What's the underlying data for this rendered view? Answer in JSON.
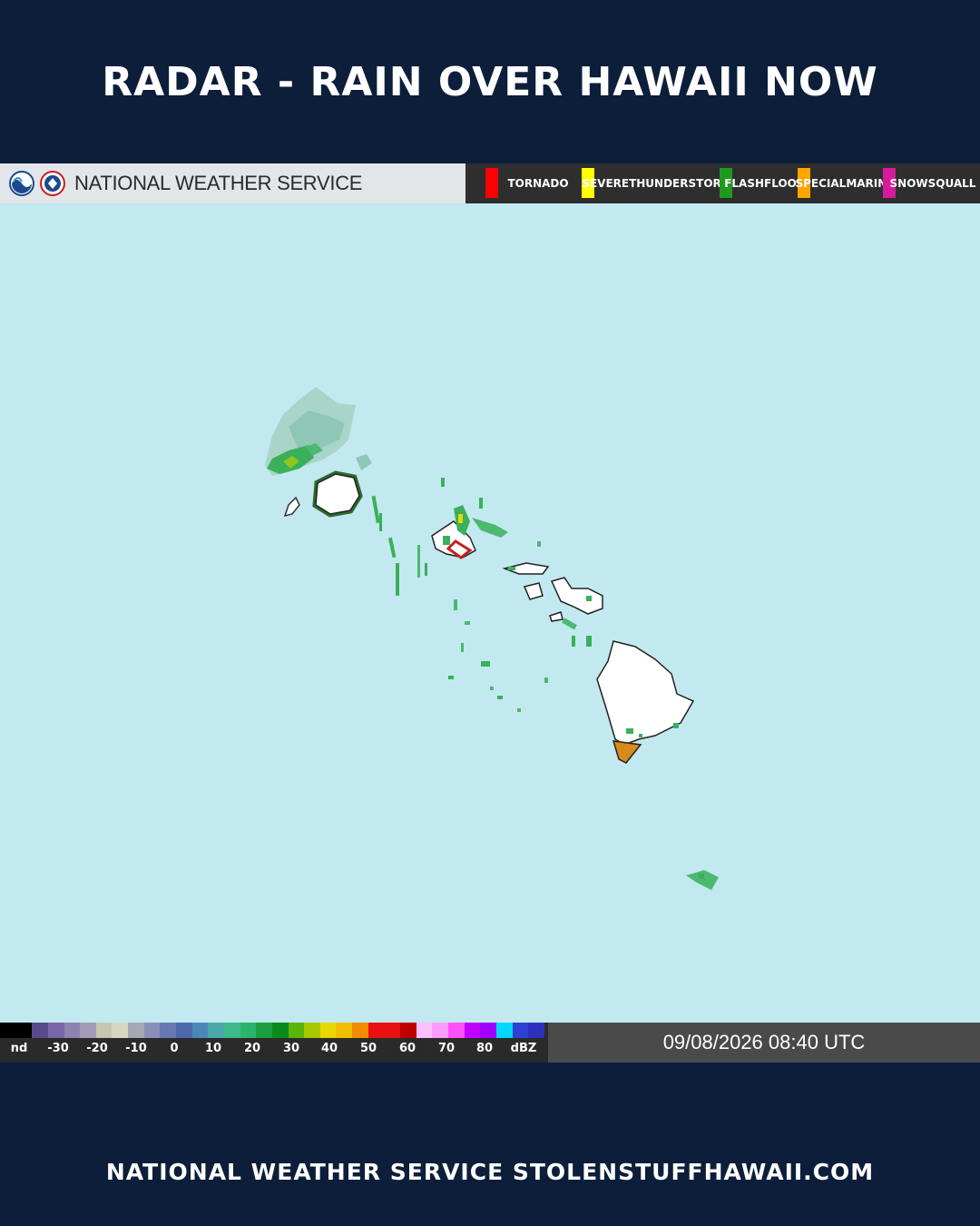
{
  "header": {
    "title": "RADAR - RAIN OVER HAWAII NOW"
  },
  "nws_bar": {
    "agency_name": "NATIONAL WEATHER SERVICE",
    "logos": [
      "noaa-logo",
      "nws-logo"
    ]
  },
  "warning_legend": {
    "items": [
      {
        "label": "TORNADO",
        "color": "#ff0000"
      },
      {
        "label": "SEVERE\nTHUNDERSTORM",
        "color": "#ffff00"
      },
      {
        "label": "FLASH\nFLOOD",
        "color": "#1f9a1f"
      },
      {
        "label": "SPECIAL\nMARINE",
        "color": "#ffa500"
      },
      {
        "label": "SNOW\nSQUALL",
        "color": "#d81b9c"
      }
    ]
  },
  "map": {
    "ocean_color": "#c2e9f0",
    "land_color": "#ffffff",
    "islands": [
      "Niihau",
      "Kauai",
      "Oahu",
      "Molokai",
      "Lanai",
      "Maui",
      "Kahoolawe",
      "Hawaii"
    ]
  },
  "reflectivity_scale": {
    "ticks": [
      "nd",
      "-30",
      "-20",
      "-10",
      "0",
      "10",
      "20",
      "30",
      "40",
      "50",
      "60",
      "70",
      "80",
      "dBZ"
    ],
    "colors": [
      "#000000",
      "#000000",
      "#5a4a8c",
      "#7a66a8",
      "#8e82b0",
      "#a39cb8",
      "#c8c6b0",
      "#d8d6c0",
      "#a8a8b4",
      "#8a90b8",
      "#6878b0",
      "#4e68ac",
      "#4a88b8",
      "#4aa8a8",
      "#3cba8c",
      "#2eb46a",
      "#1aa040",
      "#0a8a1a",
      "#5ab40a",
      "#a8c800",
      "#e8d800",
      "#f0c000",
      "#f08c00",
      "#e81010",
      "#e81010",
      "#c00000",
      "#ffc0ff",
      "#ff9cff",
      "#ff50ff",
      "#c000ff",
      "#a000ff",
      "#00d8ff",
      "#3040d0",
      "#3030c0"
    ]
  },
  "timestamp": "09/08/2026 08:40 UTC",
  "footer": {
    "text": "NATIONAL WEATHER SERVICE STOLENSTUFFHAWAII.COM"
  }
}
